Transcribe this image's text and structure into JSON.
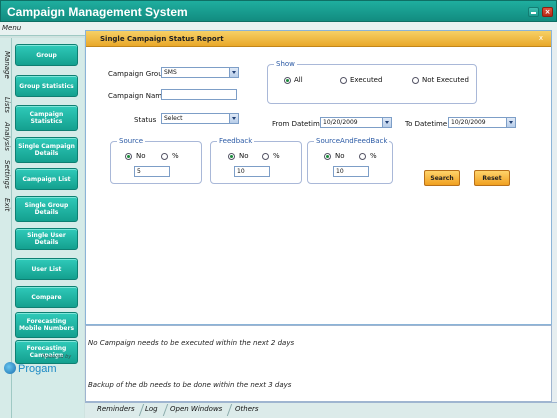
{
  "window": {
    "title": "Campaign Management System"
  },
  "menu": {
    "label": "Menu",
    "vertical_tabs": [
      "Manage",
      "Lists",
      "Analysis",
      "Settings",
      "Exit"
    ]
  },
  "sidebar": {
    "buttons": [
      "Group",
      "Group Statistics",
      "Campaign Statistics",
      "Single Campaign Details",
      "Campaign List",
      "Single Group Details",
      "Single User Details",
      "User List",
      "Compare",
      "Forecasting Mobile Numbers",
      "Forecasting Campaign"
    ],
    "logo": {
      "powered": "Powered by",
      "brand": "Progam"
    }
  },
  "report": {
    "title": "Single Campaign Status Report",
    "close_symbol": "x",
    "campaign_group_label": "Campaign Group",
    "campaign_group_value": "SMS",
    "campaign_name_label": "Campaign Name",
    "campaign_name_value": "",
    "status_label": "Status",
    "status_value": "Select",
    "show": {
      "title": "Show",
      "options": [
        "All",
        "Executed",
        "Not Executed"
      ],
      "selected_index": 0
    },
    "from_label": "From Datetime",
    "from_value": "10/20/2009",
    "to_label": "To Datetime",
    "to_value": "10/20/2009",
    "source": {
      "title": "Source",
      "options": [
        "No",
        "%"
      ],
      "selected_index": 0,
      "value": "5"
    },
    "feedback": {
      "title": "Feedback",
      "options": [
        "No",
        "%"
      ],
      "selected_index": 0,
      "value": "10"
    },
    "source_and_feedback": {
      "title": "SourceAndFeedBack",
      "options": [
        "No",
        "%"
      ],
      "selected_index": 0,
      "value": "10"
    },
    "search_label": "Search",
    "reset_label": "Reset"
  },
  "messages": [
    "No Campaign needs to be executed within the next 2 days",
    "Backup of the db needs to be done within the next 3 days"
  ],
  "bottom_tabs": [
    "Reminders",
    "Log",
    "Open Windows",
    "Others"
  ]
}
